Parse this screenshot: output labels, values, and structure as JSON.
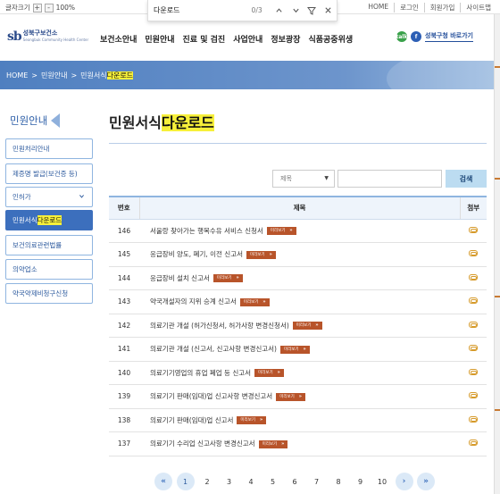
{
  "util": {
    "font_size_label": "글자크기",
    "plus": "+",
    "minus": "-",
    "zoom": "100%",
    "links": [
      "HOME",
      "로그인",
      "회원가입",
      "사이트맵"
    ]
  },
  "find": {
    "query": "다운로드",
    "count": "0/3",
    "up_icon": "chevron-up-icon",
    "down_icon": "chevron-down-icon",
    "filter_icon": "filter-icon",
    "close_icon": "close-icon"
  },
  "header": {
    "logo_mark": "sb",
    "logo_ko": "성북구보건소",
    "logo_en": "Seongbuk Community Health Center",
    "nav": [
      "보건소안내",
      "민원안내",
      "진료 및 검진",
      "사업안내",
      "정보광장",
      "식품공중위생"
    ],
    "kakao_glyph": "talk",
    "facebook_glyph": "f",
    "shortcut": "성북구청 바로가기"
  },
  "breadcrumb": {
    "home": "HOME",
    "sep": ">",
    "level1": "민원안내",
    "level2_a": "민원서식",
    "level2_b": "다운로드"
  },
  "sidebar": {
    "title": "민원안내",
    "items": [
      {
        "label": "민원처리안내"
      },
      {
        "label": "제증명 발급(보건증 등)"
      },
      {
        "label": "인허가"
      },
      {
        "label_a": "민원서식",
        "label_b": "다운로드"
      },
      {
        "label": "보건의료관련법률"
      },
      {
        "label": "의약업소"
      },
      {
        "label": "약국약제비청구신청"
      }
    ]
  },
  "main": {
    "title_a": "민원서식",
    "title_b": "다운로드",
    "search": {
      "select_value": "제목",
      "button": "검색"
    },
    "table": {
      "headers": [
        "번호",
        "제목",
        "첨부"
      ],
      "preview_label": "미리보기",
      "rows": [
        {
          "no": "146",
          "title": "서울랑 찾아가는 행복수유 서비스 신청서"
        },
        {
          "no": "145",
          "title": "응급장비 양도, 폐기, 이전 신고서"
        },
        {
          "no": "144",
          "title": "응급장비 설치 신고서"
        },
        {
          "no": "143",
          "title": "약국개설자의 지위 승계 신고서"
        },
        {
          "no": "142",
          "title": "의료기관 개설 (허가신청서, 허가사항 변경신청서)"
        },
        {
          "no": "141",
          "title": "의료기관 개설 (신고서, 신고사항 변경신고서)"
        },
        {
          "no": "140",
          "title": "의료기기영업의 휴업 폐업 등 신고서"
        },
        {
          "no": "139",
          "title": "의료기기 판매(임대)업 신고사항 변경신고서"
        },
        {
          "no": "138",
          "title": "의료기기 판매(임대)업 신고서"
        },
        {
          "no": "137",
          "title": "의료기기 수리업 신고사항 변경신고서"
        }
      ]
    },
    "pager": {
      "first": "«",
      "prev": "‹",
      "pages": [
        "1",
        "2",
        "3",
        "4",
        "5",
        "6",
        "7",
        "8",
        "9",
        "10"
      ],
      "next": "›",
      "last": "»",
      "current": "1"
    }
  },
  "colors": {
    "accent": "#3c6fbd",
    "highlight": "#f7f03a",
    "preview_button": "#b8542a"
  }
}
